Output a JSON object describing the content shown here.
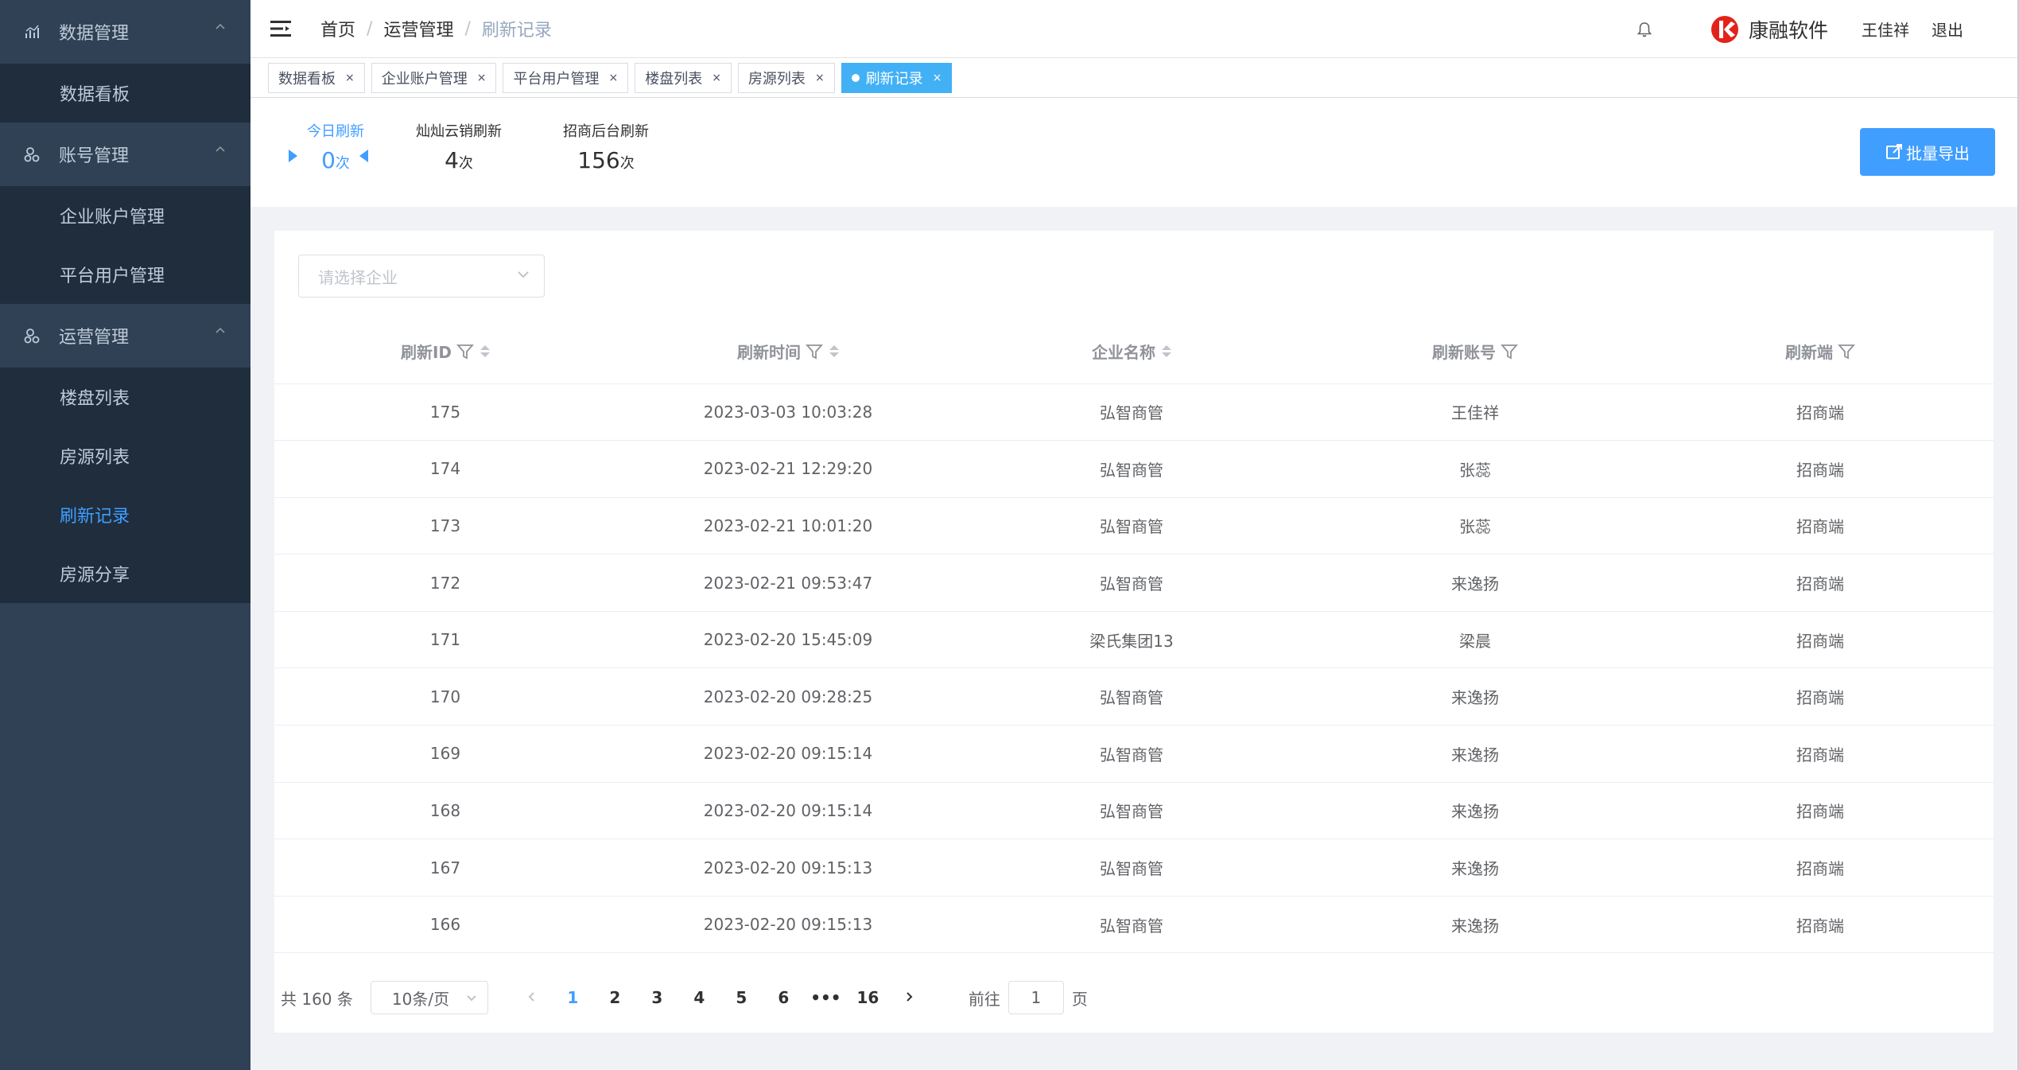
{
  "sidebar": {
    "groups": [
      {
        "label": "数据管理",
        "icon": "chart-icon",
        "items": [
          {
            "label": "数据看板",
            "active": false
          }
        ]
      },
      {
        "label": "账号管理",
        "icon": "users-icon",
        "items": [
          {
            "label": "企业账户管理",
            "active": false
          },
          {
            "label": "平台用户管理",
            "active": false
          }
        ]
      },
      {
        "label": "运营管理",
        "icon": "users-icon",
        "items": [
          {
            "label": "楼盘列表",
            "active": false
          },
          {
            "label": "房源列表",
            "active": false
          },
          {
            "label": "刷新记录",
            "active": true
          },
          {
            "label": "房源分享",
            "active": false
          }
        ]
      }
    ]
  },
  "header": {
    "breadcrumb": [
      "首页",
      "运营管理",
      "刷新记录"
    ],
    "brand": "康融软件",
    "user": "王佳祥",
    "logout": "退出"
  },
  "tags": [
    {
      "label": "数据看板",
      "active": false
    },
    {
      "label": "企业账户管理",
      "active": false
    },
    {
      "label": "平台用户管理",
      "active": false
    },
    {
      "label": "楼盘列表",
      "active": false
    },
    {
      "label": "房源列表",
      "active": false
    },
    {
      "label": "刷新记录",
      "active": true
    }
  ],
  "stats": {
    "today": {
      "label": "今日刷新",
      "value": "0",
      "unit": "次"
    },
    "cloud": {
      "label": "灿灿云销刷新",
      "value": "4",
      "unit": "次"
    },
    "backend": {
      "label": "招商后台刷新",
      "value": "156",
      "unit": "次"
    },
    "export_label": "批量导出"
  },
  "filter": {
    "company_placeholder": "请选择企业"
  },
  "table": {
    "columns": [
      "刷新ID",
      "刷新时间",
      "企业名称",
      "刷新账号",
      "刷新端"
    ],
    "rows": [
      [
        "175",
        "2023-03-03 10:03:28",
        "弘智商管",
        "王佳祥",
        "招商端"
      ],
      [
        "174",
        "2023-02-21 12:29:20",
        "弘智商管",
        "张蕊",
        "招商端"
      ],
      [
        "173",
        "2023-02-21 10:01:20",
        "弘智商管",
        "张蕊",
        "招商端"
      ],
      [
        "172",
        "2023-02-21 09:53:47",
        "弘智商管",
        "来逸扬",
        "招商端"
      ],
      [
        "171",
        "2023-02-20 15:45:09",
        "梁氏集团13",
        "梁晨",
        "招商端"
      ],
      [
        "170",
        "2023-02-20 09:28:25",
        "弘智商管",
        "来逸扬",
        "招商端"
      ],
      [
        "169",
        "2023-02-20 09:15:14",
        "弘智商管",
        "来逸扬",
        "招商端"
      ],
      [
        "168",
        "2023-02-20 09:15:14",
        "弘智商管",
        "来逸扬",
        "招商端"
      ],
      [
        "167",
        "2023-02-20 09:15:13",
        "弘智商管",
        "来逸扬",
        "招商端"
      ],
      [
        "166",
        "2023-02-20 09:15:13",
        "弘智商管",
        "来逸扬",
        "招商端"
      ]
    ]
  },
  "pagination": {
    "total": "共 160 条",
    "page_size": "10条/页",
    "pages": [
      "1",
      "2",
      "3",
      "4",
      "5",
      "6",
      "•••",
      "16"
    ],
    "current": "1",
    "goto_prefix": "前往",
    "goto_value": "1",
    "goto_suffix": "页"
  },
  "colors": {
    "accent": "#409eff",
    "sidebar_bg": "#304156",
    "submenu_bg": "#1f2d3d"
  }
}
